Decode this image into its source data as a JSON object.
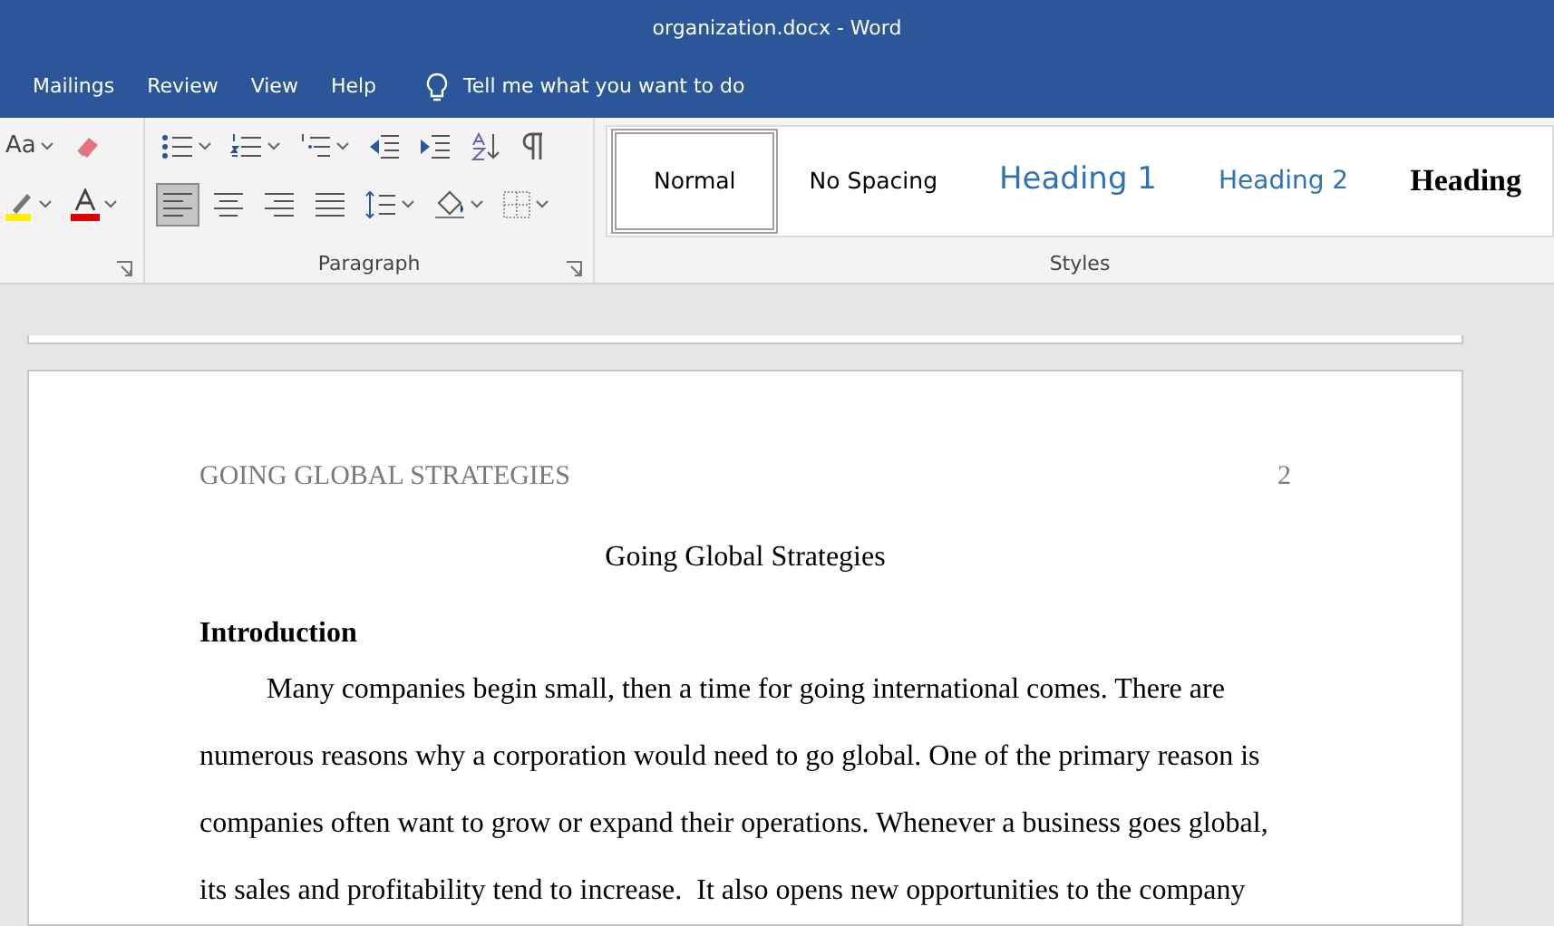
{
  "window": {
    "title": "organization.docx - Word"
  },
  "menu_tabs": [
    {
      "label": "Mailings"
    },
    {
      "label": "Review"
    },
    {
      "label": "View"
    },
    {
      "label": "Help"
    }
  ],
  "tell_me": {
    "placeholder": "Tell me what you want to do"
  },
  "font_group": {
    "change_case_label": "Aa"
  },
  "paragraph_group": {
    "label": "Paragraph",
    "alignment_buttons": [
      {
        "selected": true
      },
      {
        "selected": false
      },
      {
        "selected": false
      },
      {
        "selected": false
      }
    ]
  },
  "styles_group": {
    "label": "Styles",
    "styles": [
      {
        "name": "Normal",
        "kind": "normal",
        "selected": true
      },
      {
        "name": "No Spacing",
        "kind": "plain",
        "selected": false
      },
      {
        "name": "Heading 1",
        "kind": "heading1",
        "selected": false
      },
      {
        "name": "Heading 2",
        "kind": "heading2",
        "selected": false
      },
      {
        "name": "Heading",
        "kind": "heading3",
        "selected": false
      }
    ]
  },
  "document": {
    "header": {
      "running_head": "GOING GLOBAL STRATEGIES",
      "page_number": "2"
    },
    "title": "Going Global Strategies",
    "heading": "Introduction",
    "paragraphs": [
      "Many companies begin small, then a time for going international comes. There are numerous reasons why a corporation would need to go global. One of the primary reason is companies often want to grow or expand their operations. Whenever a business goes global, its sales and profitability tend to increase.  It also opens new opportunities to the company"
    ]
  }
}
